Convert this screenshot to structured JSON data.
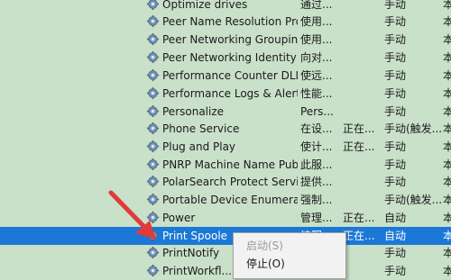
{
  "services": [
    {
      "name": "Optimize drives",
      "description": "通过...",
      "status": "",
      "startup_type": "手动",
      "logon": "本"
    },
    {
      "name": "Peer Name Resolution Pro...",
      "description": "使用...",
      "status": "",
      "startup_type": "手动",
      "logon": "本"
    },
    {
      "name": "Peer Networking Grouping",
      "description": "使用...",
      "status": "",
      "startup_type": "手动",
      "logon": "本"
    },
    {
      "name": "Peer Networking Identity ...",
      "description": "向对...",
      "status": "",
      "startup_type": "手动",
      "logon": "本"
    },
    {
      "name": "Performance Counter DLL ...",
      "description": "使远...",
      "status": "",
      "startup_type": "手动",
      "logon": "本"
    },
    {
      "name": "Performance Logs & Alerts",
      "description": "性能...",
      "status": "",
      "startup_type": "手动",
      "logon": "本"
    },
    {
      "name": "Personalize",
      "description": "Pers...",
      "status": "",
      "startup_type": "手动",
      "logon": "本"
    },
    {
      "name": "Phone Service",
      "description": "在设...",
      "status": "正在...",
      "startup_type": "手动(触发...",
      "logon": "本"
    },
    {
      "name": "Plug and Play",
      "description": "使计...",
      "status": "正在...",
      "startup_type": "手动",
      "logon": "本"
    },
    {
      "name": "PNRP Machine Name Publ...",
      "description": "此服...",
      "status": "",
      "startup_type": "手动",
      "logon": "本"
    },
    {
      "name": "PolarSearch Protect Service",
      "description": "提供...",
      "status": "",
      "startup_type": "手动",
      "logon": "本"
    },
    {
      "name": "Portable Device Enumerat...",
      "description": "强制...",
      "status": "",
      "startup_type": "手动(触发...",
      "logon": "本"
    },
    {
      "name": "Power",
      "description": "管理...",
      "status": "正在...",
      "startup_type": "自动",
      "logon": "本"
    },
    {
      "name": "Print Spoole",
      "description": "该服...",
      "status": "正在...",
      "startup_type": "自动",
      "logon": "本",
      "selected": true
    },
    {
      "name": "PrintNotify",
      "description": "",
      "status": "",
      "startup_type": "手动",
      "logon": "本"
    },
    {
      "name": "PrintWorkfl...",
      "description": "",
      "status": "",
      "startup_type": "手动",
      "logon": "本"
    }
  ],
  "context_menu": {
    "items": [
      {
        "label": "启动(S)",
        "enabled": false
      },
      {
        "label": "停止(O)",
        "enabled": true
      }
    ]
  },
  "colors": {
    "background": "#c9e0c9",
    "selection": "#1c78d6",
    "arrow": "#e03a3a"
  },
  "icons": {
    "service": "gear-icon",
    "annotation": "red-arrow-icon"
  }
}
